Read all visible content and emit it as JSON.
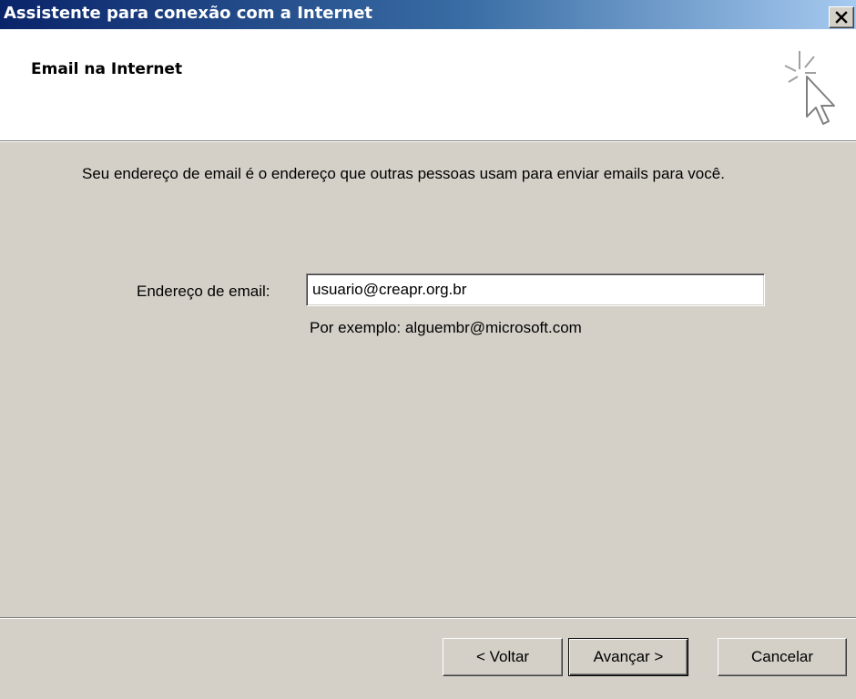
{
  "window": {
    "title": "Assistente para conexão com a Internet",
    "close_symbol": "✕"
  },
  "header": {
    "title": "Email na Internet",
    "icon": "wizard-cursor-sparkle-icon"
  },
  "content": {
    "description": "Seu endereço de email é o endereço que outras pessoas usam para enviar emails para você.",
    "email_label": "Endereço de email:",
    "email_value": "usuario@creapr.org.br",
    "example": "Por exemplo: alguembr@microsoft.com"
  },
  "buttons": {
    "back": "< Voltar",
    "next": "Avançar >",
    "cancel": "Cancelar"
  },
  "colors": {
    "titlebar_start": "#0a246a",
    "titlebar_end": "#a6caf0",
    "dialog_bg": "#d4d0c8"
  }
}
